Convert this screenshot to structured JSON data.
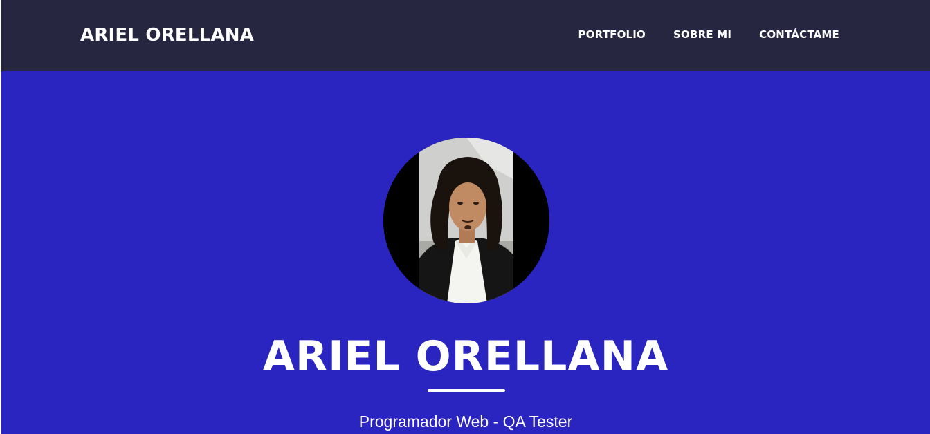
{
  "navbar": {
    "brand": "ARIEL ORELLANA",
    "links": [
      {
        "label": "PORTFOLIO"
      },
      {
        "label": "SOBRE MI"
      },
      {
        "label": "CONTÁCTAME"
      }
    ]
  },
  "hero": {
    "title": "ARIEL ORELLANA",
    "subtitle": "Programador Web - QA Tester"
  },
  "colors": {
    "navbar_bg": "#272640",
    "hero_bg": "#2a24c0",
    "text": "#ffffff"
  }
}
